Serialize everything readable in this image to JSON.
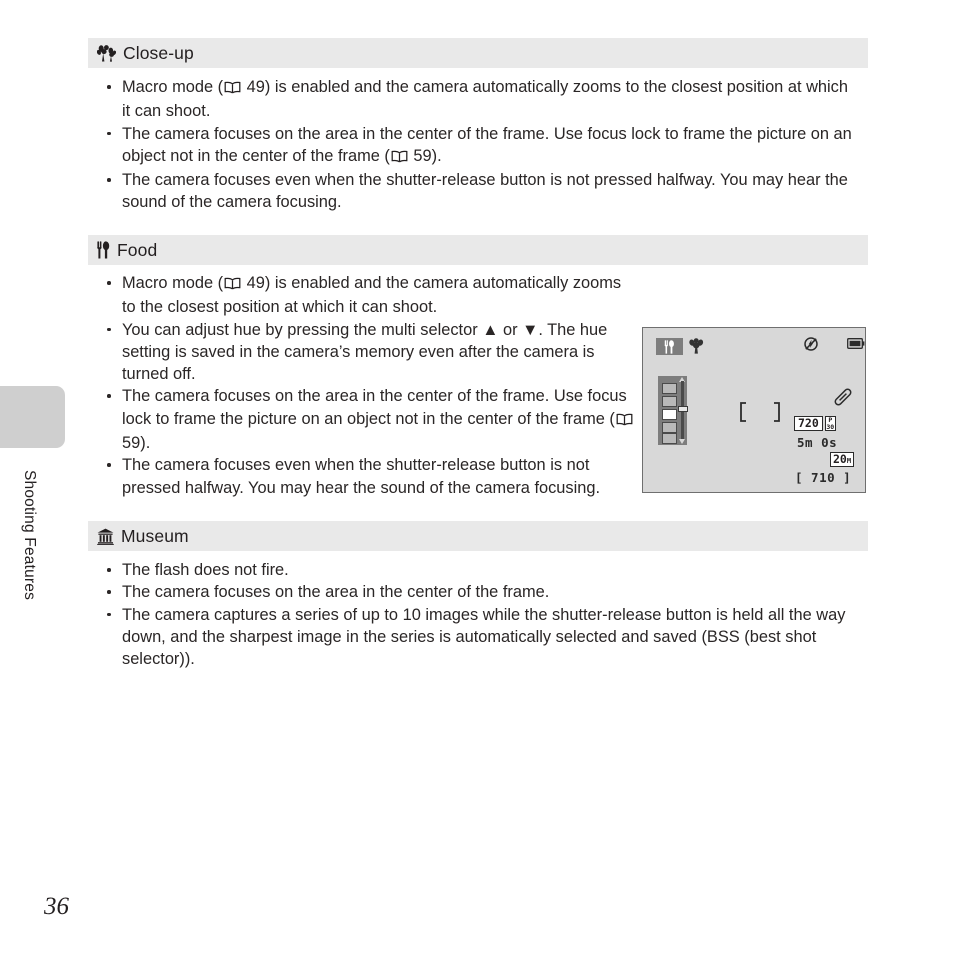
{
  "page": {
    "number": "36",
    "side_tab_label": "Shooting Features"
  },
  "sections": [
    {
      "id": "close-up",
      "icon": "macro-flower-icon",
      "title": "Close-up",
      "bullets": [
        {
          "pre": "Macro mode (",
          "book": true,
          "ref": " 49",
          "post": ") is enabled and the camera automatically zooms to the closest position at which it can shoot."
        },
        {
          "pre": "The camera focuses on the area in the center of the frame. Use focus lock to frame the picture on an object not in the center of the frame (",
          "book": true,
          "ref": " 59",
          "post": ")."
        },
        {
          "pre": "The camera focuses even when the shutter-release button is not pressed halfway. You may hear the sound of the camera focusing.",
          "book": false,
          "ref": "",
          "post": ""
        }
      ]
    },
    {
      "id": "food",
      "icon": "food-fork-knife-icon",
      "title": "Food",
      "bullets": [
        {
          "pre": "Macro mode (",
          "book": true,
          "ref": " 49",
          "post": ") is enabled and the camera automatically zooms to the closest position at which it can shoot."
        },
        {
          "pre": "You can adjust hue by pressing the multi selector ▲ or ▼. The hue setting is saved in the camera’s memory even after the camera is turned off.",
          "book": false,
          "ref": "",
          "post": ""
        },
        {
          "pre": "The camera focuses on the area in the center of the frame. Use focus lock to frame the picture on an object not in the center of the frame (",
          "book": true,
          "ref": " 59",
          "post": ")."
        },
        {
          "pre": "The camera focuses even when the shutter-release button is not pressed halfway. You may hear the sound of the camera focusing.",
          "book": false,
          "ref": "",
          "post": ""
        }
      ]
    },
    {
      "id": "museum",
      "icon": "museum-building-icon",
      "title": "Museum",
      "bullets": [
        {
          "pre": "The flash does not fire.",
          "book": false,
          "ref": "",
          "post": ""
        },
        {
          "pre": "The camera focuses on the area in the center of the frame.",
          "book": false,
          "ref": "",
          "post": ""
        },
        {
          "pre": "The camera captures a series of up to 10 images while the shutter-release button is held all the way down, and the sharpest image in the series is automatically selected and saved (BSS (best shot selector)).",
          "book": false,
          "ref": "",
          "post": ""
        }
      ]
    }
  ],
  "lcd": {
    "mode_icon": "food-fork-knife-icon",
    "macro_icon": "macro-flower-icon",
    "flash_icon": "flash-off-icon",
    "battery_icon": "battery-full-icon",
    "vr_icon": "vibration-reduction-icon",
    "focus_brackets": "focus-area-brackets",
    "movie_quality": "720",
    "movie_fps_top": "P",
    "movie_fps": "30",
    "record_time": "5m 0s",
    "image_size": "20",
    "image_size_unit": "M",
    "shots_remaining": "[ 710 ]",
    "hue_swatch_count": 5,
    "hue_selected_index": 2
  },
  "colors": {
    "header_band": "#e9e9e9",
    "side_tab": "#cfcfcf",
    "lcd_background": "#d8d8d8",
    "lcd_panel": "#7d7d7d",
    "text": "#231f20"
  }
}
